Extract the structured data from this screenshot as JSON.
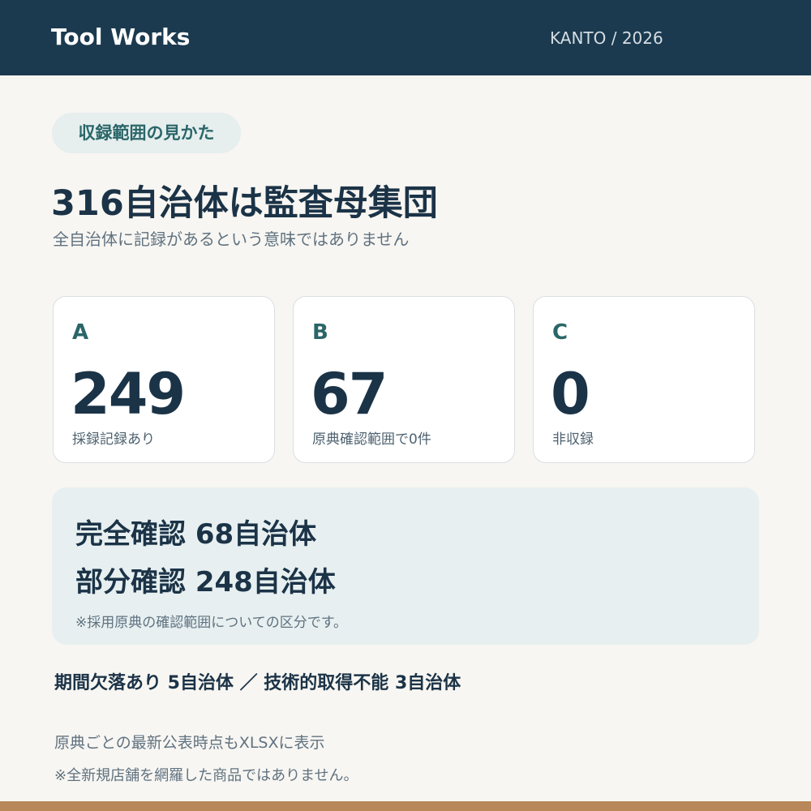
{
  "header": {
    "brand": "Tool Works",
    "region": "KANTO / 2026"
  },
  "badge": {
    "label": "収録範囲の見かた"
  },
  "headline": {
    "title": "316自治体は監査母集団",
    "subtitle": "全自治体に記録があるという意味ではありません"
  },
  "cards": [
    {
      "letter": "A",
      "value": "249",
      "label": "採録記録あり"
    },
    {
      "letter": "B",
      "value": "67",
      "label": "原典確認範囲で0件"
    },
    {
      "letter": "C",
      "value": "0",
      "label": "非収録"
    }
  ],
  "confirmation": {
    "line1": "完全確認 68自治体",
    "line2": "部分確認 248自治体",
    "note": "※採用原典の確認範囲についての区分です。"
  },
  "stats_line": "期間欠落あり 5自治体 ／ 技術的取得不能 3自治体",
  "footer": {
    "line1": "原典ごとの最新公表時点もXLSXに表示",
    "line2": "※全新規店舗を網羅した商品ではありません。"
  },
  "colors": {
    "header_bg": "#1b3a4f",
    "accent_teal": "#2a6668",
    "page_bg": "#f8f6f2",
    "panel_bg": "#e7eff0",
    "bottom_bar": "#b8875a"
  }
}
